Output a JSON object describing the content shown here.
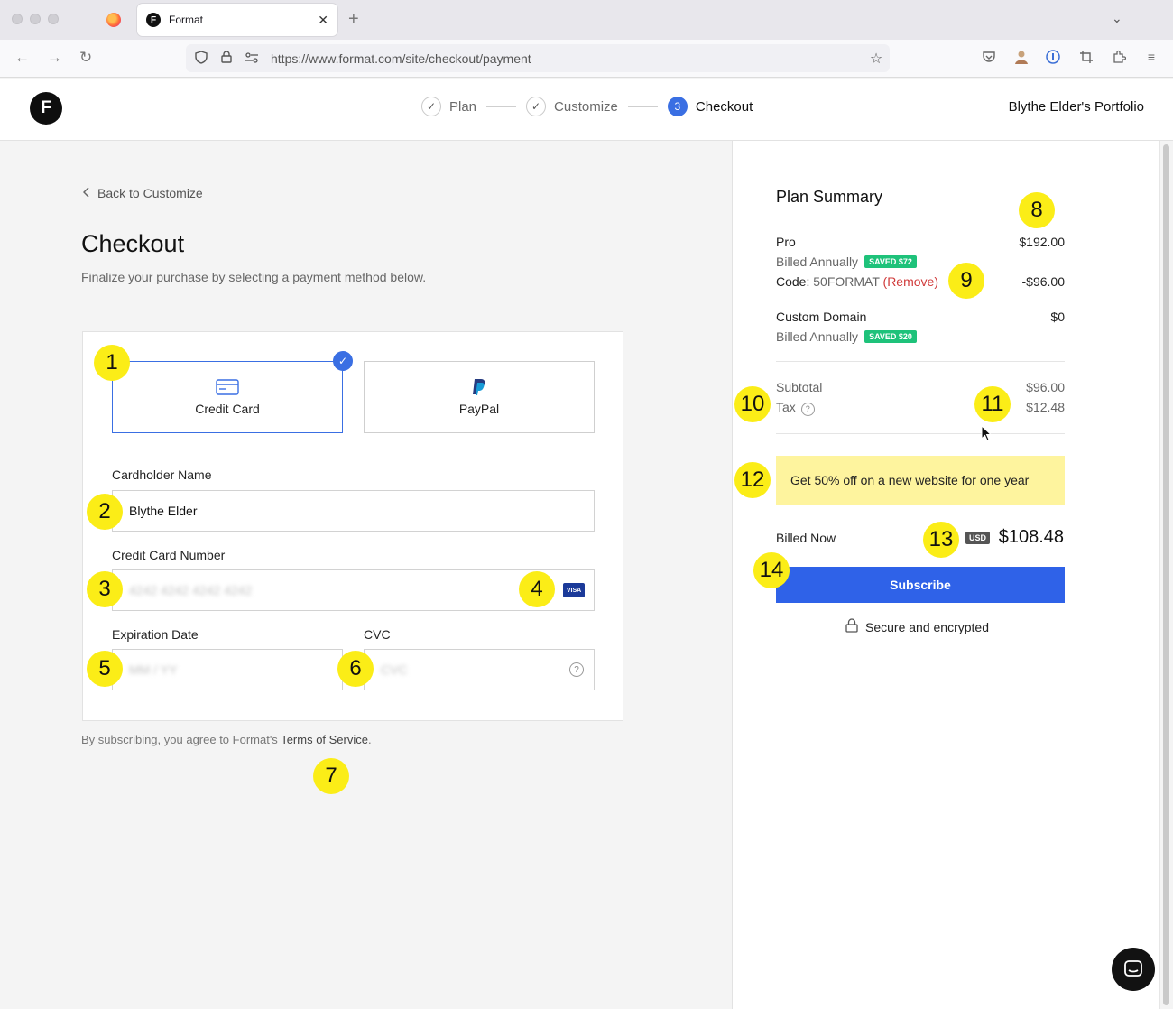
{
  "browser": {
    "tab_title": "Format",
    "tab_favicon": "F",
    "url": "https://www.format.com/site/checkout/payment"
  },
  "header": {
    "logo": "F",
    "steps": [
      {
        "label": "Plan",
        "state": "done"
      },
      {
        "label": "Customize",
        "state": "done"
      },
      {
        "label": "Checkout",
        "number": "3",
        "state": "active"
      }
    ],
    "portfolio": "Blythe Elder's Portfolio"
  },
  "checkout": {
    "back_link": "Back to Customize",
    "title": "Checkout",
    "subtitle": "Finalize your purchase by selecting a payment method below.",
    "methods": [
      {
        "label": "Credit Card",
        "icon": "credit-card-icon",
        "selected": true
      },
      {
        "label": "PayPal",
        "icon": "paypal-icon",
        "selected": false
      }
    ],
    "cardholder": {
      "label": "Cardholder Name",
      "value": "Blythe Elder"
    },
    "card_number": {
      "label": "Credit Card Number",
      "placeholder": "4242 4242 4242 4242",
      "brand": "VISA"
    },
    "expiration": {
      "label": "Expiration Date",
      "placeholder": "MM / YY"
    },
    "cvc": {
      "label": "CVC",
      "placeholder": "CVC"
    },
    "terms_prefix": "By subscribing, you agree to Format's ",
    "terms_link": "Terms of Service",
    "terms_suffix": "."
  },
  "summary": {
    "title": "Plan Summary",
    "pro_label": "Pro",
    "pro_price": "$192.00",
    "pro_billing": "Billed Annually",
    "pro_saved": "SAVED $72",
    "code_prefix": "Code:",
    "code": "50FORMAT",
    "code_remove": "(Remove)",
    "code_discount": "-$96.00",
    "domain_label": "Custom Domain",
    "domain_price": "$0",
    "domain_billing": "Billed Annually",
    "domain_saved": "SAVED $20",
    "subtotal_label": "Subtotal",
    "subtotal": "$96.00",
    "tax_label": "Tax",
    "tax": "$12.48",
    "promo": "Get 50% off on a new website for one year",
    "billed_now_label": "Billed Now",
    "currency": "USD",
    "billed_now": "$108.48",
    "subscribe": "Subscribe",
    "secure": "Secure and encrypted"
  },
  "markers": [
    "1",
    "2",
    "3",
    "4",
    "5",
    "6",
    "7",
    "8",
    "9",
    "10",
    "11",
    "12",
    "13",
    "14"
  ],
  "colors": {
    "accent": "#2f62e8",
    "marker": "#fbed17",
    "saved_badge": "#1ec27a",
    "promo_bg": "#fef49e",
    "remove": "#d03a3a",
    "discount": "#1c9a64"
  }
}
